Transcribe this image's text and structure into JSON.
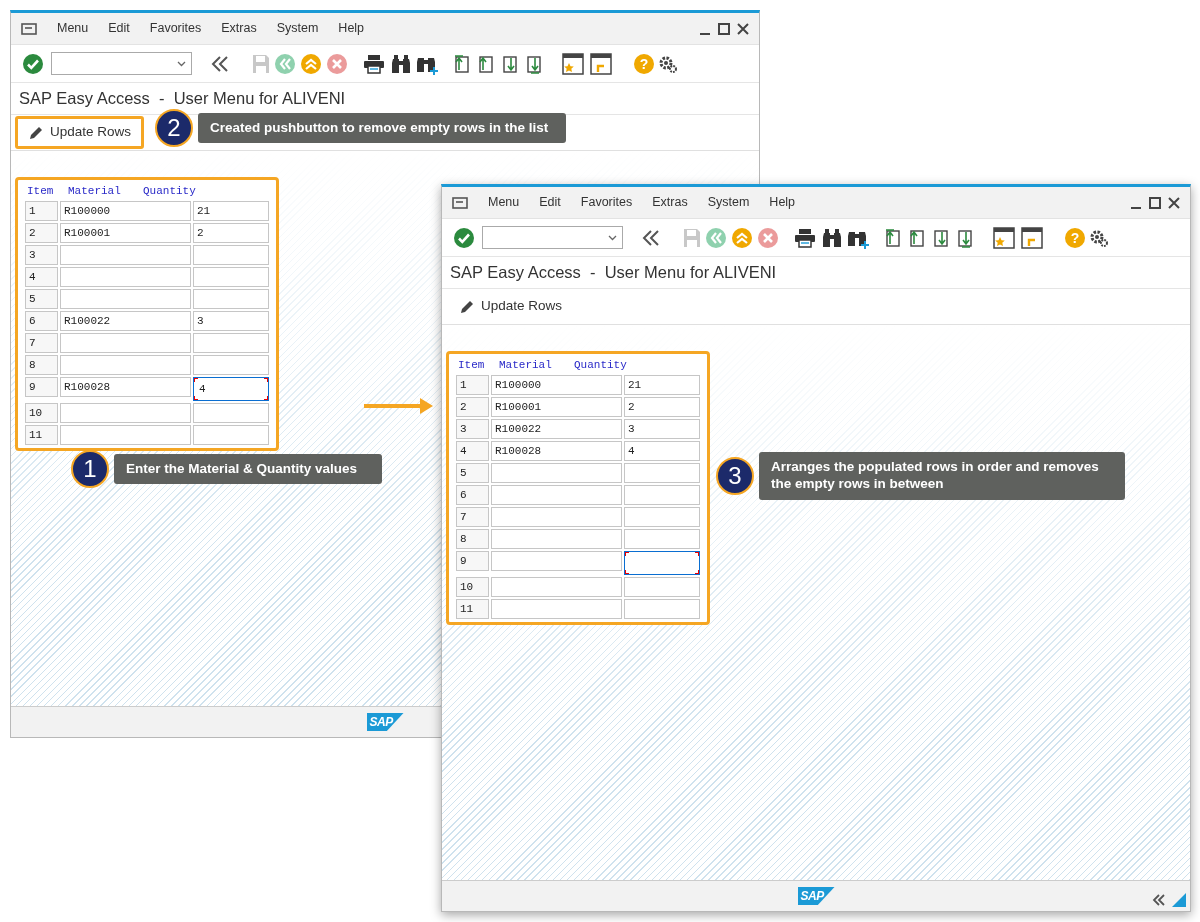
{
  "windows": [
    {
      "menu": [
        "Menu",
        "Edit",
        "Favorites",
        "Extras",
        "System",
        "Help"
      ],
      "help_glyph": "?",
      "title": "SAP Easy Access  -  User Menu for ALIVENI",
      "app_button": {
        "label": "Update Rows",
        "highlighted": true
      },
      "table": {
        "highlighted": true,
        "columns": [
          "Item",
          "Material",
          "Quantity"
        ],
        "rows": [
          {
            "item": "1",
            "material": "R100000",
            "quantity": "21",
            "focused": false
          },
          {
            "item": "2",
            "material": "R100001",
            "quantity": "2",
            "focused": false
          },
          {
            "item": "3",
            "material": "",
            "quantity": "",
            "focused": false
          },
          {
            "item": "4",
            "material": "",
            "quantity": "",
            "focused": false
          },
          {
            "item": "5",
            "material": "",
            "quantity": "",
            "focused": false
          },
          {
            "item": "6",
            "material": "R100022",
            "quantity": "3",
            "focused": false
          },
          {
            "item": "7",
            "material": "",
            "quantity": "",
            "focused": false
          },
          {
            "item": "8",
            "material": "",
            "quantity": "",
            "focused": false
          },
          {
            "item": "9",
            "material": "R100028",
            "quantity": "4",
            "focused": true
          },
          {
            "item": "10",
            "material": "",
            "quantity": "",
            "focused": false
          },
          {
            "item": "11",
            "material": "",
            "quantity": "",
            "focused": false
          }
        ]
      },
      "logo": "SAP",
      "corner_controls": false
    },
    {
      "menu": [
        "Menu",
        "Edit",
        "Favorites",
        "Extras",
        "System",
        "Help"
      ],
      "help_glyph": "?",
      "title": "SAP Easy Access  -  User Menu for ALIVENI",
      "app_button": {
        "label": "Update Rows",
        "highlighted": false
      },
      "table": {
        "highlighted": true,
        "columns": [
          "Item",
          "Material",
          "Quantity"
        ],
        "rows": [
          {
            "item": "1",
            "material": "R100000",
            "quantity": "21",
            "focused": false
          },
          {
            "item": "2",
            "material": "R100001",
            "quantity": "2",
            "focused": false
          },
          {
            "item": "3",
            "material": "R100022",
            "quantity": "3",
            "focused": false
          },
          {
            "item": "4",
            "material": "R100028",
            "quantity": "4",
            "focused": false
          },
          {
            "item": "5",
            "material": "",
            "quantity": "",
            "focused": false
          },
          {
            "item": "6",
            "material": "",
            "quantity": "",
            "focused": false
          },
          {
            "item": "7",
            "material": "",
            "quantity": "",
            "focused": false
          },
          {
            "item": "8",
            "material": "",
            "quantity": "",
            "focused": false
          },
          {
            "item": "9",
            "material": "",
            "quantity": "",
            "focused": true
          },
          {
            "item": "10",
            "material": "",
            "quantity": "",
            "focused": false
          },
          {
            "item": "11",
            "material": "",
            "quantity": "",
            "focused": false
          }
        ]
      },
      "logo": "SAP",
      "corner_controls": true
    }
  ],
  "annotations": [
    {
      "number": "1",
      "text": "Enter the Material & Quantity values"
    },
    {
      "number": "2",
      "text": "Created pushbutton to remove empty rows in the list"
    },
    {
      "number": "3",
      "text": "Arranges the populated rows in order and removes the empty rows in between"
    }
  ]
}
